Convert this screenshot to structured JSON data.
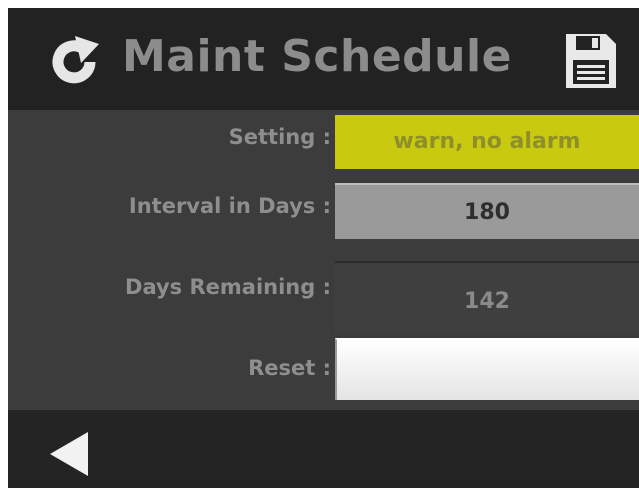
{
  "header": {
    "title": "Maint Schedule",
    "refresh_icon": "refresh-icon",
    "save_icon": "save-icon"
  },
  "rows": [
    {
      "label": "Setting :",
      "value": "warn, no alarm"
    },
    {
      "label": "Interval in Days :",
      "value": "180"
    },
    {
      "label": "Days Remaining :",
      "value": "142"
    },
    {
      "label": "Reset :",
      "value": ""
    }
  ],
  "footer": {
    "back_icon": "back-arrow-icon"
  },
  "colors": {
    "background": "#3c3c3c",
    "header_bar": "#222222",
    "label_text": "#8e8e8e",
    "setting_field": "#c9c90f",
    "interval_field": "#9a9a9a",
    "remaining_field": "#3f3f3f",
    "reset_field": "#f4f4f4"
  }
}
